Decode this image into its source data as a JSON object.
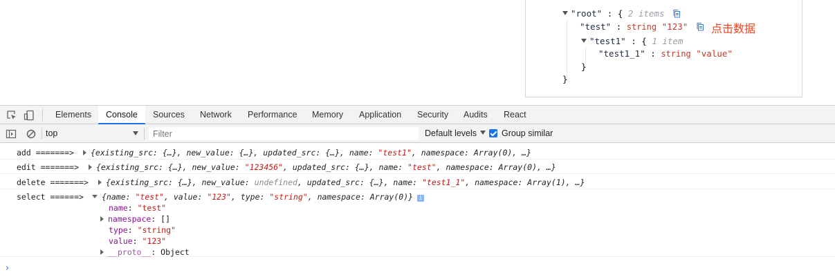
{
  "json_viewer": {
    "root_key": "\"root\"",
    "root_open": ": {",
    "root_count": "2 items",
    "test_key": "\"test\"",
    "test_colon": ":",
    "test_type": "string",
    "test_value": "\"123\"",
    "test1_key": "\"test1\"",
    "test1_open": ": {",
    "test1_count": "1 item",
    "test1_1_key": "\"test1_1\"",
    "test1_1_colon": ":",
    "test1_1_type": "string",
    "test1_1_value": "\"value\"",
    "close_inner": "}",
    "close_outer": "}",
    "annotation": "点击数据",
    "annotation_color": "#e8441d"
  },
  "devtools": {
    "tabs": [
      "Elements",
      "Console",
      "Sources",
      "Network",
      "Performance",
      "Memory",
      "Application",
      "Security",
      "Audits",
      "React"
    ],
    "active_tab": "Console",
    "toolbar": {
      "context": "top",
      "filter_placeholder": "Filter",
      "levels": "Default levels",
      "group_similar": "Group similar"
    },
    "accent_color": "#1a73e8"
  },
  "console": {
    "add": {
      "label": "add =======>",
      "p1": "{existing_src: {…}, new_value: {…}, updated_src: {…}, name: ",
      "name": "\"test1\"",
      "p2": ", namespace: Array(0), …}"
    },
    "edit": {
      "label": "edit =======>",
      "p1": "{existing_src: {…}, new_value: ",
      "new_value": "\"123456\"",
      "p2": ", updated_src: {…}, name: ",
      "name": "\"test\"",
      "p3": ", namespace: Array(0), …}"
    },
    "delete": {
      "label": "delete =======>",
      "p1": "{existing_src: {…}, new_value: ",
      "undef": "undefined",
      "p2": ", updated_src: {…}, name: ",
      "name": "\"test1_1\"",
      "p3": ", namespace: Array(1), …}"
    },
    "select": {
      "label": "select ======>",
      "p1": "{name: ",
      "name": "\"test\"",
      "p2": ", value: ",
      "value": "\"123\"",
      "p3": ", type: ",
      "type": "\"string\"",
      "p4": ", namespace: Array(0)}",
      "info": "i",
      "props": {
        "name_key": "name",
        "name_val": "\"test\"",
        "ns_key": "namespace",
        "ns_val": "[]",
        "type_key": "type",
        "type_val": "\"string\"",
        "value_key": "value",
        "value_val": "\"123\"",
        "proto_key": "__proto__",
        "proto_val": "Object"
      }
    },
    "prompt": "›"
  }
}
